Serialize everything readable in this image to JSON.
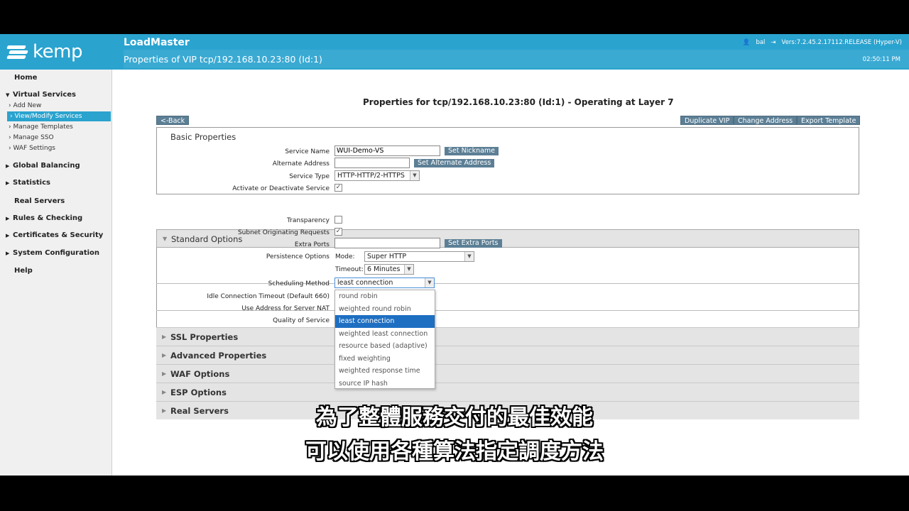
{
  "app": {
    "logo_text": "kemp",
    "title": "LoadMaster",
    "subtitle": "Properties of VIP tcp/192.168.10.23:80 (Id:1)",
    "user": "bal",
    "version": "Vers:7.2.45.2.17112.RELEASE (Hyper-V)",
    "clock": "02:50:11 PM"
  },
  "sidebar": {
    "home": "Home",
    "virtual_services": "Virtual Services",
    "vs_items": [
      "Add New",
      "View/Modify Services",
      "Manage Templates",
      "Manage SSO",
      "WAF Settings"
    ],
    "global_balancing": "Global Balancing",
    "statistics": "Statistics",
    "real_servers": "Real Servers",
    "rules_checking": "Rules & Checking",
    "certificates_security": "Certificates & Security",
    "system_configuration": "System Configuration",
    "help": "Help"
  },
  "main": {
    "page_title": "Properties for tcp/192.168.10.23:80 (Id:1) - Operating at Layer 7",
    "back": "<-Back",
    "duplicate_vip": "Duplicate VIP",
    "change_address": "Change Address",
    "export_template": "Export Template"
  },
  "basic": {
    "heading": "Basic Properties",
    "service_name_label": "Service Name",
    "service_name_value": "WUI-Demo-VS",
    "set_nickname": "Set Nickname",
    "alternate_address_label": "Alternate Address",
    "alternate_address_value": "",
    "set_alternate_address": "Set Alternate Address",
    "service_type_label": "Service Type",
    "service_type_value": "HTTP-HTTP/2-HTTPS",
    "activate_label": "Activate or Deactivate Service",
    "activate_checked": "✓"
  },
  "standard": {
    "heading": "Standard Options",
    "transparency_label": "Transparency",
    "transparency_checked": "",
    "subnet_label": "Subnet Originating Requests",
    "subnet_checked": "✓",
    "extra_ports_label": "Extra Ports",
    "extra_ports_value": "",
    "set_extra_ports": "Set Extra Ports",
    "persistence_label": "Persistence Options",
    "mode_label": "Mode:",
    "mode_value": "Super HTTP",
    "timeout_label": "Timeout:",
    "timeout_value": "6 Minutes",
    "scheduling_label": "Scheduling Method",
    "scheduling_value": "least connection",
    "idle_label": "Idle Connection Timeout (Default 660)",
    "nat_label": "Use Address for Server NAT",
    "qos_label": "Quality of Service",
    "scheduling_options": [
      "round robin",
      "weighted round robin",
      "least connection",
      "weighted least connection",
      "resource based (adaptive)",
      "fixed weighting",
      "weighted response time",
      "source IP hash"
    ],
    "selected_index": 2
  },
  "sections": [
    "SSL Properties",
    "Advanced Properties",
    "WAF Options",
    "ESP Options",
    "Real Servers"
  ],
  "subtitles": [
    "為了整體服務交付的最佳效能",
    "可以使用各種算法指定調度方法"
  ],
  "colors": {
    "brand": "#2aa3cf",
    "button": "#5c7f95",
    "selected": "#1e6fc2"
  }
}
